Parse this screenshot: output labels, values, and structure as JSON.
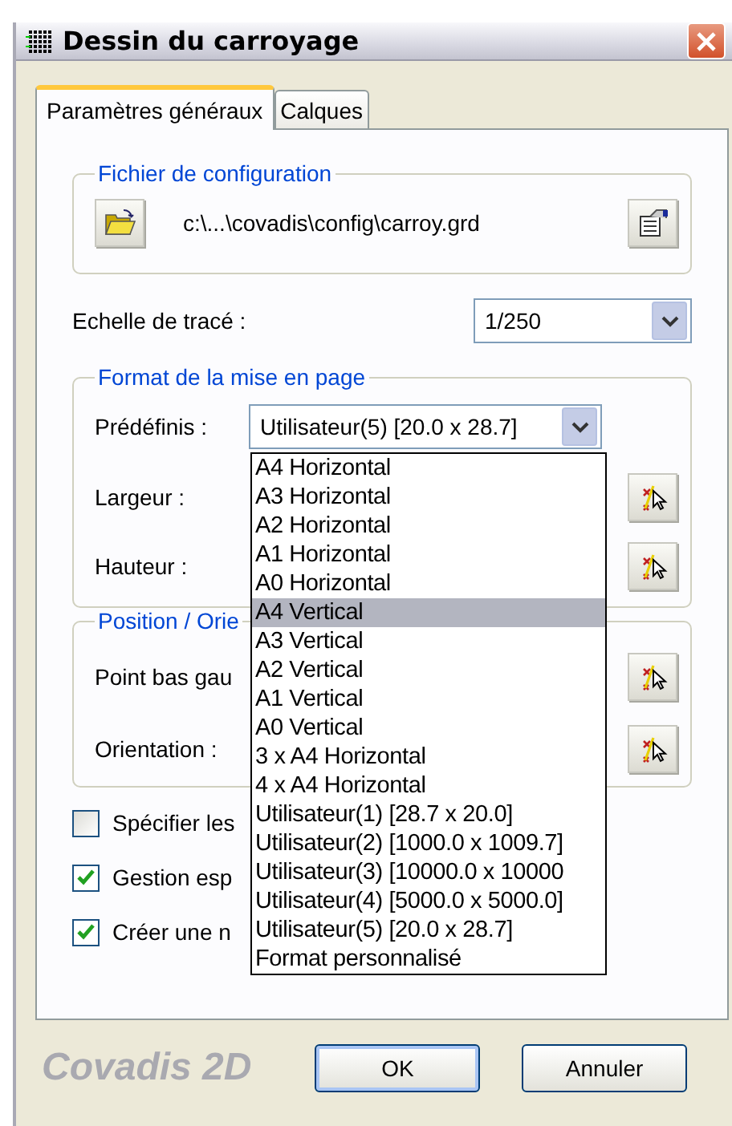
{
  "window": {
    "title": "Dessin du carroyage"
  },
  "tabs": [
    {
      "label": "Paramètres généraux",
      "selected": true
    },
    {
      "label": "Calques",
      "selected": false
    }
  ],
  "config_group": {
    "legend": "Fichier de configuration",
    "path": "c:\\...\\covadis\\config\\carroy.grd"
  },
  "scale": {
    "label": "Echelle de tracé :",
    "value": "1/250"
  },
  "format_group": {
    "legend": "Format de la mise en page",
    "preset_label": "Prédéfinis :",
    "preset_value": "Utilisateur(5) [20.0 x 28.7]",
    "width_label": "Largeur :",
    "height_label": "Hauteur :",
    "dropdown": [
      {
        "label": "A4 Horizontal",
        "selected": false
      },
      {
        "label": "A3 Horizontal",
        "selected": false
      },
      {
        "label": "A2 Horizontal",
        "selected": false
      },
      {
        "label": "A1 Horizontal",
        "selected": false
      },
      {
        "label": "A0 Horizontal",
        "selected": false
      },
      {
        "label": "A4 Vertical",
        "selected": true
      },
      {
        "label": "A3 Vertical",
        "selected": false
      },
      {
        "label": "A2 Vertical",
        "selected": false
      },
      {
        "label": "A1 Vertical",
        "selected": false
      },
      {
        "label": "A0 Vertical",
        "selected": false
      },
      {
        "label": "3 x A4 Horizontal",
        "selected": false
      },
      {
        "label": "4 x A4 Horizontal",
        "selected": false
      },
      {
        "label": "Utilisateur(1) [28.7 x 20.0]",
        "selected": false
      },
      {
        "label": "Utilisateur(2) [1000.0 x 1009.7]",
        "selected": false
      },
      {
        "label": "Utilisateur(3) [10000.0 x 10000",
        "selected": false
      },
      {
        "label": "Utilisateur(4) [5000.0 x 5000.0]",
        "selected": false
      },
      {
        "label": "Utilisateur(5) [20.0 x 28.7]",
        "selected": false
      },
      {
        "label": "Format personnalisé",
        "selected": false
      }
    ]
  },
  "position_group": {
    "legend": "Position / Orie",
    "point_label": "Point bas gau",
    "orientation_label": "Orientation :"
  },
  "options": [
    {
      "label": "Spécifier les",
      "checked": false
    },
    {
      "label": "Gestion esp",
      "checked": true
    },
    {
      "label": "Créer une n",
      "checked": true
    }
  ],
  "footer": {
    "logo": "Covadis 2D",
    "buttons": [
      "OK",
      "Annuler"
    ]
  }
}
